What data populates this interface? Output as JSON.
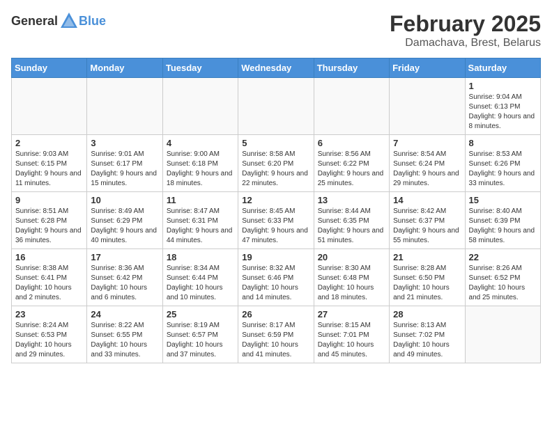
{
  "logo": {
    "general": "General",
    "blue": "Blue"
  },
  "title": {
    "month": "February 2025",
    "location": "Damachava, Brest, Belarus"
  },
  "weekdays": [
    "Sunday",
    "Monday",
    "Tuesday",
    "Wednesday",
    "Thursday",
    "Friday",
    "Saturday"
  ],
  "weeks": [
    [
      {
        "day": "",
        "info": ""
      },
      {
        "day": "",
        "info": ""
      },
      {
        "day": "",
        "info": ""
      },
      {
        "day": "",
        "info": ""
      },
      {
        "day": "",
        "info": ""
      },
      {
        "day": "",
        "info": ""
      },
      {
        "day": "1",
        "info": "Sunrise: 9:04 AM\nSunset: 6:13 PM\nDaylight: 9 hours and 8 minutes."
      }
    ],
    [
      {
        "day": "2",
        "info": "Sunrise: 9:03 AM\nSunset: 6:15 PM\nDaylight: 9 hours and 11 minutes."
      },
      {
        "day": "3",
        "info": "Sunrise: 9:01 AM\nSunset: 6:17 PM\nDaylight: 9 hours and 15 minutes."
      },
      {
        "day": "4",
        "info": "Sunrise: 9:00 AM\nSunset: 6:18 PM\nDaylight: 9 hours and 18 minutes."
      },
      {
        "day": "5",
        "info": "Sunrise: 8:58 AM\nSunset: 6:20 PM\nDaylight: 9 hours and 22 minutes."
      },
      {
        "day": "6",
        "info": "Sunrise: 8:56 AM\nSunset: 6:22 PM\nDaylight: 9 hours and 25 minutes."
      },
      {
        "day": "7",
        "info": "Sunrise: 8:54 AM\nSunset: 6:24 PM\nDaylight: 9 hours and 29 minutes."
      },
      {
        "day": "8",
        "info": "Sunrise: 8:53 AM\nSunset: 6:26 PM\nDaylight: 9 hours and 33 minutes."
      }
    ],
    [
      {
        "day": "9",
        "info": "Sunrise: 8:51 AM\nSunset: 6:28 PM\nDaylight: 9 hours and 36 minutes."
      },
      {
        "day": "10",
        "info": "Sunrise: 8:49 AM\nSunset: 6:29 PM\nDaylight: 9 hours and 40 minutes."
      },
      {
        "day": "11",
        "info": "Sunrise: 8:47 AM\nSunset: 6:31 PM\nDaylight: 9 hours and 44 minutes."
      },
      {
        "day": "12",
        "info": "Sunrise: 8:45 AM\nSunset: 6:33 PM\nDaylight: 9 hours and 47 minutes."
      },
      {
        "day": "13",
        "info": "Sunrise: 8:44 AM\nSunset: 6:35 PM\nDaylight: 9 hours and 51 minutes."
      },
      {
        "day": "14",
        "info": "Sunrise: 8:42 AM\nSunset: 6:37 PM\nDaylight: 9 hours and 55 minutes."
      },
      {
        "day": "15",
        "info": "Sunrise: 8:40 AM\nSunset: 6:39 PM\nDaylight: 9 hours and 58 minutes."
      }
    ],
    [
      {
        "day": "16",
        "info": "Sunrise: 8:38 AM\nSunset: 6:41 PM\nDaylight: 10 hours and 2 minutes."
      },
      {
        "day": "17",
        "info": "Sunrise: 8:36 AM\nSunset: 6:42 PM\nDaylight: 10 hours and 6 minutes."
      },
      {
        "day": "18",
        "info": "Sunrise: 8:34 AM\nSunset: 6:44 PM\nDaylight: 10 hours and 10 minutes."
      },
      {
        "day": "19",
        "info": "Sunrise: 8:32 AM\nSunset: 6:46 PM\nDaylight: 10 hours and 14 minutes."
      },
      {
        "day": "20",
        "info": "Sunrise: 8:30 AM\nSunset: 6:48 PM\nDaylight: 10 hours and 18 minutes."
      },
      {
        "day": "21",
        "info": "Sunrise: 8:28 AM\nSunset: 6:50 PM\nDaylight: 10 hours and 21 minutes."
      },
      {
        "day": "22",
        "info": "Sunrise: 8:26 AM\nSunset: 6:52 PM\nDaylight: 10 hours and 25 minutes."
      }
    ],
    [
      {
        "day": "23",
        "info": "Sunrise: 8:24 AM\nSunset: 6:53 PM\nDaylight: 10 hours and 29 minutes."
      },
      {
        "day": "24",
        "info": "Sunrise: 8:22 AM\nSunset: 6:55 PM\nDaylight: 10 hours and 33 minutes."
      },
      {
        "day": "25",
        "info": "Sunrise: 8:19 AM\nSunset: 6:57 PM\nDaylight: 10 hours and 37 minutes."
      },
      {
        "day": "26",
        "info": "Sunrise: 8:17 AM\nSunset: 6:59 PM\nDaylight: 10 hours and 41 minutes."
      },
      {
        "day": "27",
        "info": "Sunrise: 8:15 AM\nSunset: 7:01 PM\nDaylight: 10 hours and 45 minutes."
      },
      {
        "day": "28",
        "info": "Sunrise: 8:13 AM\nSunset: 7:02 PM\nDaylight: 10 hours and 49 minutes."
      },
      {
        "day": "",
        "info": ""
      }
    ]
  ]
}
